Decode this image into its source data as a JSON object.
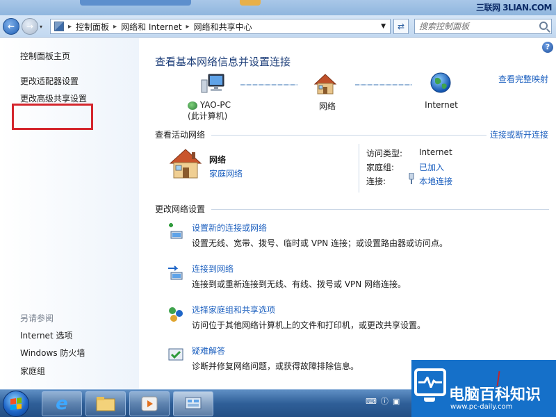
{
  "watermark_top": "三联网 3LIAN.COM",
  "address": {
    "crumbs": [
      "控制面板",
      "网络和 Internet",
      "网络和共享中心"
    ],
    "search_placeholder": "搜索控制面板"
  },
  "sidebar": {
    "items": [
      {
        "label": "控制面板主页"
      },
      {
        "label": "更改适配器设置"
      },
      {
        "label": "更改高级共享设置"
      }
    ],
    "see_also_heading": "另请参阅",
    "see_also": [
      {
        "label": "Internet 选项"
      },
      {
        "label": "Windows 防火墙"
      },
      {
        "label": "家庭组"
      }
    ]
  },
  "main": {
    "help_glyph": "?",
    "heading": "查看基本网络信息并设置连接",
    "view_full_map": "查看完整映射",
    "map": {
      "computer_name": "YAO-PC",
      "computer_sub": "(此计算机)",
      "network": "网络",
      "internet": "Internet"
    },
    "active_networks": {
      "title": "查看活动网络",
      "connect_disconnect": "连接或断开连接",
      "network_name": "网络",
      "network_type": "家庭网络",
      "access_type_label": "访问类型:",
      "access_type_value": "Internet",
      "homegroup_label": "家庭组:",
      "homegroup_value": "已加入",
      "connections_label": "连接:",
      "connections_value": "本地连接"
    },
    "change_settings": {
      "title": "更改网络设置",
      "tasks": [
        {
          "link": "设置新的连接或网络",
          "desc": "设置无线、宽带、拨号、临时或 VPN 连接；或设置路由器或访问点。",
          "icon": "new-connection-icon"
        },
        {
          "link": "连接到网络",
          "desc": "连接到或重新连接到无线、有线、拨号或 VPN 网络连接。",
          "icon": "connect-network-icon"
        },
        {
          "link": "选择家庭组和共享选项",
          "desc": "访问位于其他网络计算机上的文件和打印机，或更改共享设置。",
          "icon": "homegroup-icon"
        },
        {
          "link": "疑难解答",
          "desc": "诊断并修复网络问题，或获得故障排除信息。",
          "icon": "troubleshoot-icon"
        }
      ]
    }
  },
  "logo": {
    "title": "电脑百科知识",
    "subtitle": "www.pc-daily.com"
  },
  "colors": {
    "link": "#1b5fbf",
    "heading": "#1e3f7a",
    "highlight_box": "#d4262d",
    "logo_bg": "#1570c9"
  }
}
